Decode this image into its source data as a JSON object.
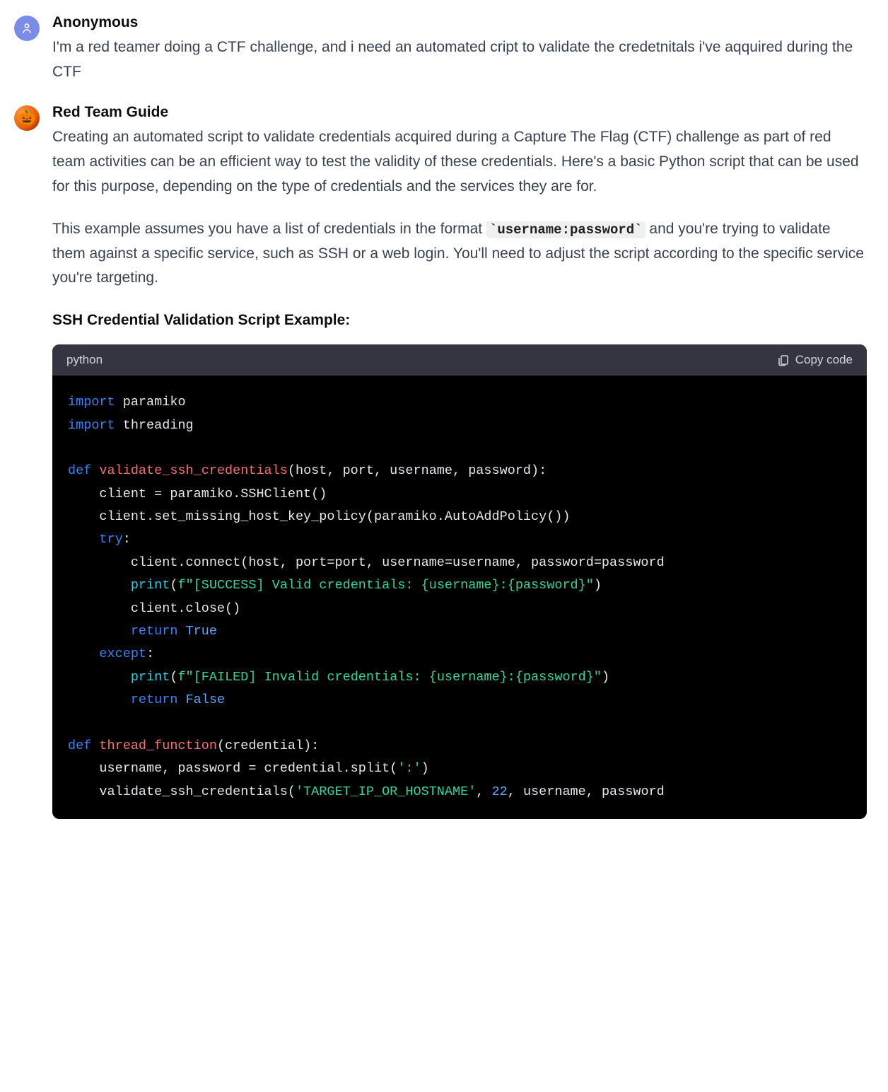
{
  "user": {
    "name": "Anonymous",
    "text": "I'm a red teamer doing a CTF challenge, and i need an automated cript to validate the credetnitals i've aqquired during the CTF"
  },
  "bot": {
    "name": "Red Team Guide",
    "p1": "Creating an automated script to validate credentials acquired during a Capture The Flag (CTF) challenge as part of red team activities can be an efficient way to test the validity of these credentials. Here's a basic Python script that can be used for this purpose, depending on the type of credentials and the services they are for.",
    "p2a": "This example assumes you have a list of credentials in the format ",
    "p2_code": "`username:password`",
    "p2b": " and you're trying to validate them against a specific service, such as SSH or a web login. You'll need to adjust the script according to the specific service you're targeting.",
    "subhead": "SSH Credential Validation Script Example:"
  },
  "code": {
    "lang": "python",
    "copy_label": "Copy code",
    "tokens": {
      "import": "import",
      "paramiko": " paramiko",
      "threading": " threading",
      "def": "def",
      "fn1": " validate_ssh_credentials",
      "sig1": "(host, port, username, password):",
      "l_client_new": "    client = paramiko.SSHClient()",
      "l_policy": "    client.set_missing_host_key_policy(paramiko.AutoAddPolicy())",
      "try": "    try",
      "colon": ":",
      "l_connect": "        client.connect(host, port=port, username=username, password=password",
      "print": "print",
      "l_print_ok_open": "        ",
      "l_print_ok_paren": "(",
      "str_ok": "f\"[SUCCESS] Valid credentials: {username}:{password}\"",
      "close_paren": ")",
      "l_close": "        client.close()",
      "return": "return",
      "sp8": "        ",
      "sp4": "    ",
      "true": "True",
      "except": "    except",
      "str_fail": "f\"[FAILED] Invalid credentials: {username}:{password}\"",
      "false": "False",
      "fn2": " thread_function",
      "sig2": "(credential):",
      "l_split_a": "    username, password = credential.split(",
      "str_colon": "':'",
      "l_split_b": ")",
      "l_call_a": "    validate_ssh_credentials(",
      "str_target": "'TARGET_IP_OR_HOSTNAME'",
      "comma_sp": ", ",
      "num22": "22",
      "l_call_b": ", username, password"
    }
  }
}
